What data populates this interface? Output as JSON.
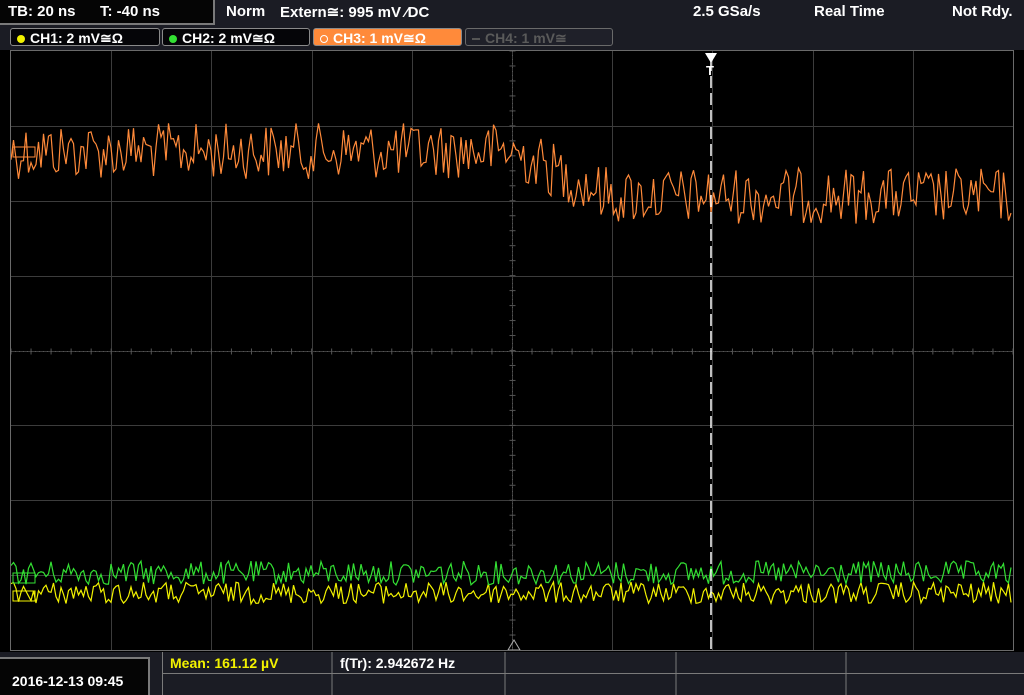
{
  "status": {
    "timebase": "TB: 20 ns",
    "trigger_time": "T: -40 ns",
    "mode": "Norm",
    "trigger_source": "Extern≅: 995 mV ⁄DC",
    "sample_rate": "2.5 GSa/s",
    "acquisition": "Real Time",
    "state": "Not Rdy."
  },
  "channels": [
    {
      "label": "CH1: 2 mV≅Ω",
      "color": "#f2f200"
    },
    {
      "label": "CH2: 2 mV≅Ω",
      "color": "#33e033"
    },
    {
      "label": "CH3: 1 mV≅Ω",
      "color": "#ff8a3a"
    },
    {
      "label": "CH4: 1 mV≅",
      "color": "#555555"
    }
  ],
  "measurements": {
    "mean": "Mean: 161.12 µV",
    "frequency": "f(Tr): 2.942672 Hz"
  },
  "datetime": "2016-12-13 09:45",
  "trigger_marker": "T"
}
